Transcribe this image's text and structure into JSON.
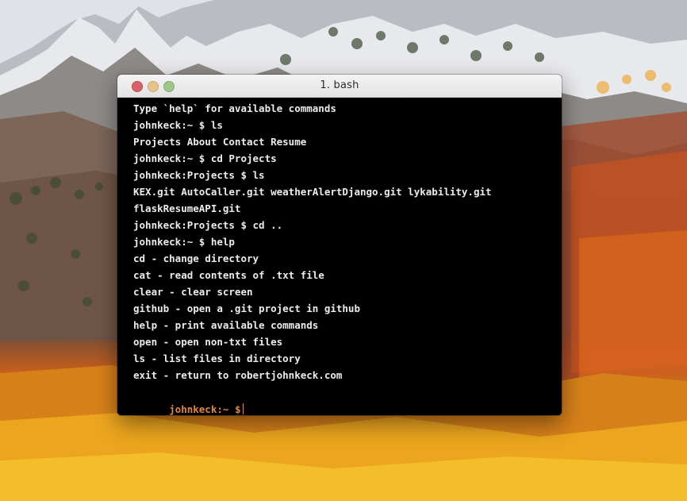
{
  "window": {
    "title": "1. bash"
  },
  "terminal": {
    "lines": [
      "Type `help` for available commands",
      "johnkeck:~ $ ls",
      "Projects About Contact Resume",
      "johnkeck:~ $ cd Projects",
      "johnkeck:Projects $ ls",
      "KEX.git AutoCaller.git weatherAlertDjango.git lykability.git",
      "flaskResumeAPI.git",
      "johnkeck:Projects $ cd ..",
      "johnkeck:~ $ help",
      "cd - change directory",
      "cat - read contents of .txt file",
      "clear - clear screen",
      "github - open a .git project in github",
      "help - print available commands",
      "open - open non-txt files",
      "ls - list files in directory",
      "exit - return to robertjohnkeck.com"
    ],
    "prompt": "johnkeck:~ $",
    "input_value": ""
  },
  "colors": {
    "prompt": "#e2863c",
    "text": "#ececec",
    "background": "#000000",
    "close": "#d8616a",
    "minimize": "#e4c38c",
    "maximize": "#9fc58d"
  },
  "icons": {
    "close": "close-button-icon",
    "minimize": "minimize-button-icon",
    "maximize": "zoom-button-icon"
  }
}
